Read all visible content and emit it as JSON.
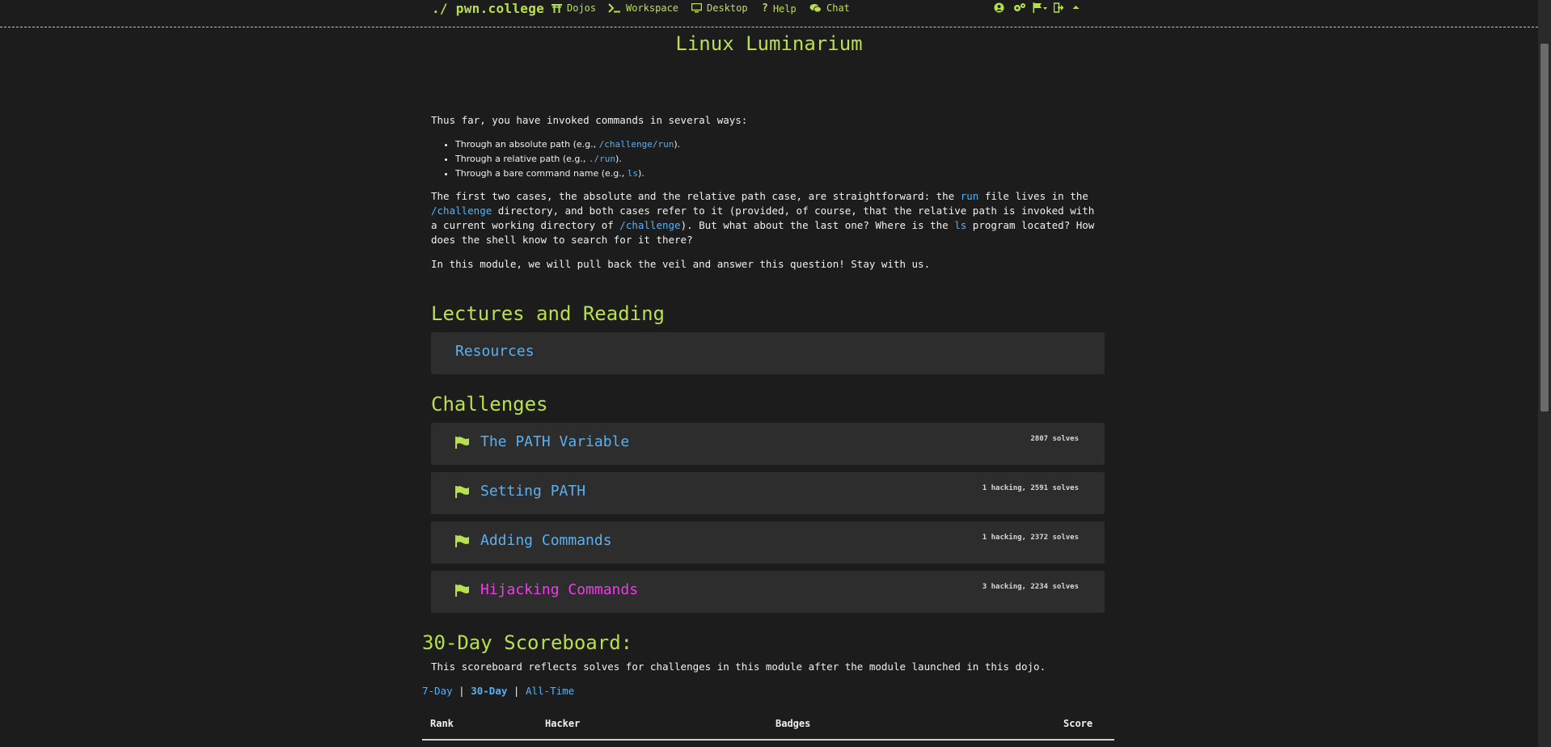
{
  "nav": {
    "brand": "./ pwn.college",
    "items": [
      {
        "label": "Dojos"
      },
      {
        "label": "Workspace"
      },
      {
        "label": "Desktop"
      },
      {
        "label": "Help"
      },
      {
        "label": "Chat"
      }
    ]
  },
  "module_title": "Linux Luminarium",
  "intro": {
    "lead": "Thus far, you have invoked commands in several ways:",
    "ways": [
      {
        "pre": "Through an absolute path (e.g., ",
        "code": "/challenge/run",
        "post": ")."
      },
      {
        "pre": "Through a relative path (e.g., ",
        "code": "./run",
        "post": ")."
      },
      {
        "pre": "Through a bare command name (e.g., ",
        "code": "ls",
        "post": ")."
      }
    ],
    "p2": {
      "a": "The first two cases, the absolute and the relative path case, are straightforward: the ",
      "code1": "run",
      "b": " file lives in the ",
      "code2": "/challenge",
      "c": " directory, and both cases refer to it (provided, of course, that the relative path is invoked with a current working directory of ",
      "code3": "/challenge",
      "d": "). But what about the last one? Where is the ",
      "code4": "ls",
      "e": " program located? How does the shell know to search for it there?"
    },
    "p3": "In this module, we will pull back the veil and answer this question! Stay with us."
  },
  "lectures": {
    "heading": "Lectures and Reading",
    "resources_label": "Resources"
  },
  "challenges": {
    "heading": "Challenges",
    "items": [
      {
        "title": "The PATH Variable",
        "solves": "2807 solves",
        "hacking": false
      },
      {
        "title": "Setting PATH",
        "solves": "1 hacking, 2591 solves",
        "hacking": false
      },
      {
        "title": "Adding Commands",
        "solves": "1 hacking, 2372 solves",
        "hacking": false
      },
      {
        "title": "Hijacking Commands",
        "solves": "3 hacking, 2234 solves",
        "hacking": true
      }
    ]
  },
  "scoreboard": {
    "title": "30-Day Scoreboard:",
    "description": "This scoreboard reflects solves for challenges in this module after the module launched in this dojo.",
    "tabs": [
      {
        "label": "7-Day"
      },
      {
        "label": "30-Day",
        "active": true
      },
      {
        "label": "All-Time"
      }
    ],
    "separator": "|",
    "columns": [
      "Rank",
      "Hacker",
      "Badges",
      "Score"
    ]
  },
  "colors": {
    "accent": "#b8e04c",
    "link": "#5ab0f0",
    "hot": "#ee3ce8",
    "panel": "#2d2d2d",
    "bg": "#1c1c1c"
  }
}
